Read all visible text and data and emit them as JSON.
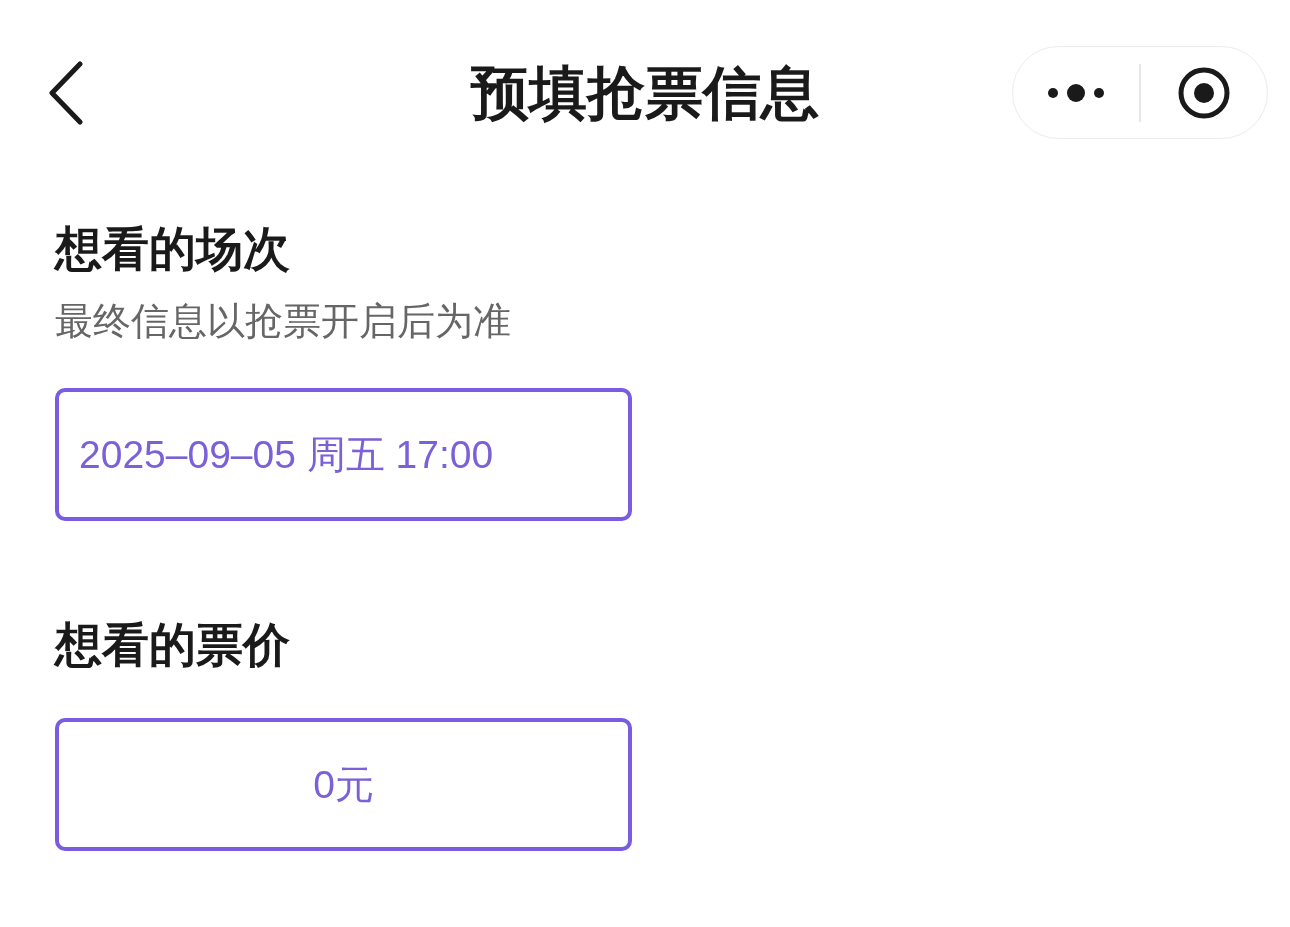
{
  "nav_bar": {
    "title": "预填抢票信息"
  },
  "sections": [
    {
      "kind": "session",
      "heading": "想看的场次",
      "subtitle": "最终信息以抢票开启后为准",
      "options": [
        {
          "label": "2025–09–05 周五 17:00",
          "selected": true
        }
      ]
    },
    {
      "kind": "price",
      "heading": "想看的票价",
      "options": [
        {
          "label": "0元",
          "selected": true
        }
      ]
    }
  ]
}
